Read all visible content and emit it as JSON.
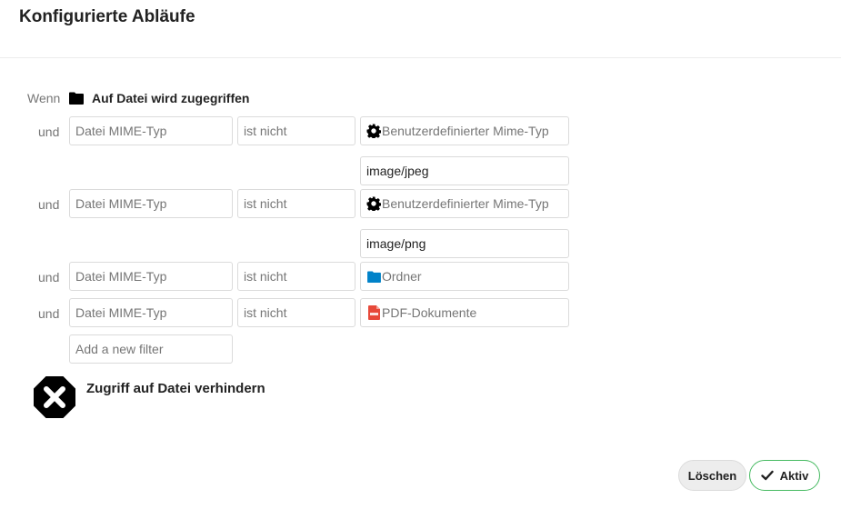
{
  "header": {
    "title": "Konfigurierte Abläufe"
  },
  "trigger": {
    "when_label": "Wenn",
    "event_label": "Auf Datei wird zugegriffen",
    "event_icon": "folder-icon"
  },
  "filters": [
    {
      "conj": "und",
      "type": "Datei MIME-Typ",
      "op": "ist nicht",
      "value_icon": "gear-icon",
      "value": "Benutzerdefinierter Mime-Typ",
      "custom": "image/jpeg"
    },
    {
      "conj": "und",
      "type": "Datei MIME-Typ",
      "op": "ist nicht",
      "value_icon": "gear-icon",
      "value": "Benutzerdefinierter Mime-Typ",
      "custom": "image/png"
    },
    {
      "conj": "und",
      "type": "Datei MIME-Typ",
      "op": "ist nicht",
      "value_icon": "folder-icon",
      "value": "Ordner"
    },
    {
      "conj": "und",
      "type": "Datei MIME-Typ",
      "op": "ist nicht",
      "value_icon": "pdf-icon",
      "value": "PDF-Dokumente"
    }
  ],
  "new_filter": {
    "placeholder": "Add a new filter"
  },
  "action": {
    "label": "Zugriff auf Datei verhindern",
    "icon": "block-icon"
  },
  "buttons": {
    "delete": "Löschen",
    "active": "Aktiv"
  },
  "colors": {
    "accent_green": "#46ba61",
    "folder_blue": "#0082c9",
    "pdf_red": "#e7493a"
  }
}
